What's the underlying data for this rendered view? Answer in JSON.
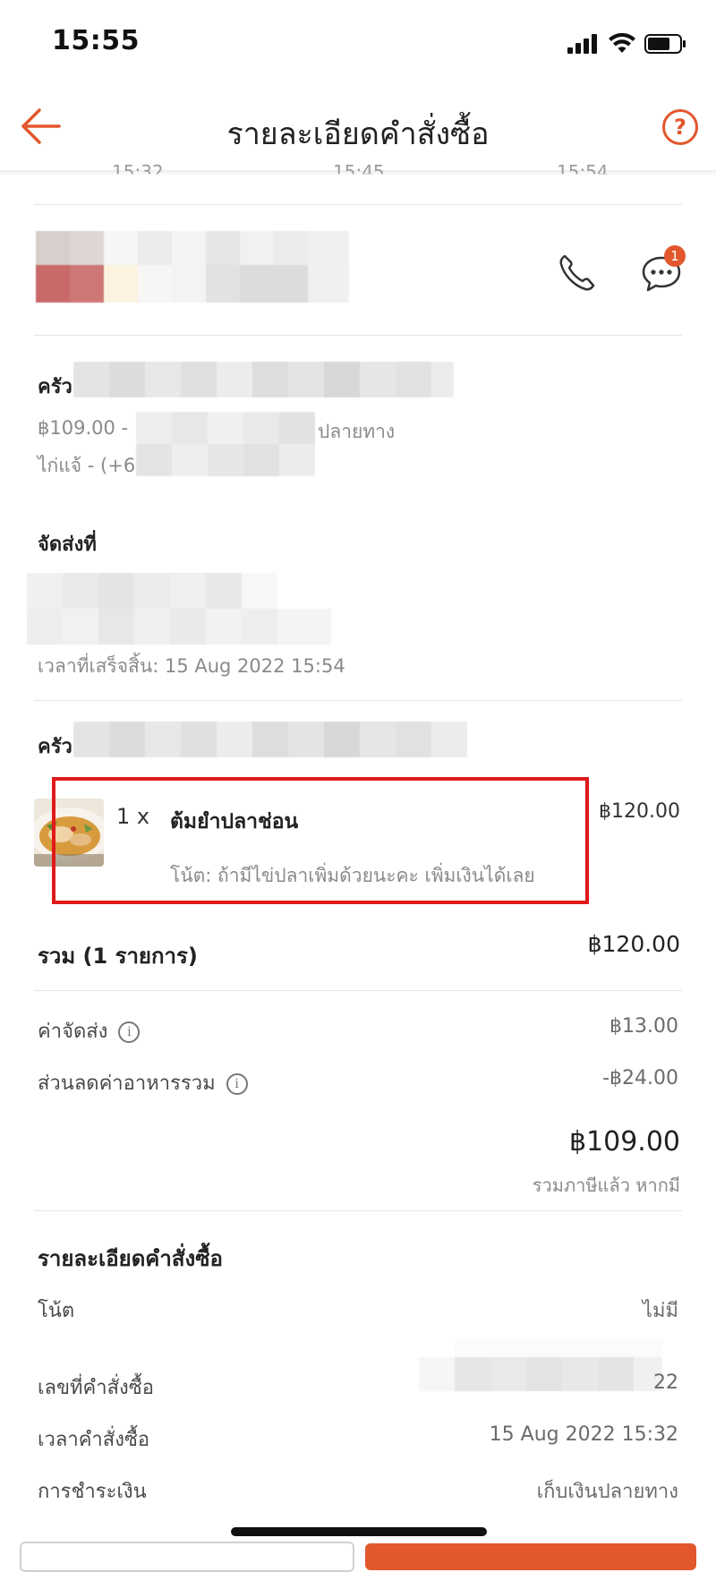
{
  "status_bar": {
    "time": "15:55"
  },
  "header": {
    "title": "รายละเอียดคำสั่งซื้อ",
    "help_symbol": "?"
  },
  "timeline": {
    "times": [
      "15:32",
      "15:45",
      "15:54"
    ]
  },
  "driver": {
    "chat_badge": "1"
  },
  "pickup": {
    "title_prefix": "ครัว",
    "price_line_prefix": "฿109.00 -",
    "price_line_suffix": "ปลายทาง",
    "contact_prefix": "ไก่แจ้ - (+6"
  },
  "delivery": {
    "title": "จัดส่งที่",
    "completed_time": "เวลาที่เสร็จสิ้น: 15 Aug 2022 15:54"
  },
  "order": {
    "restaurant_prefix": "ครัว",
    "item": {
      "qty": "1 x",
      "name": "ต้มยำปลาช่อน",
      "note": "โน้ต: ถ้ามีไข่ปลาเพิ่มด้วยนะคะ เพิ่มเงินได้เลย",
      "price": "฿120.00"
    },
    "subtotal_label": "รวม (1 รายการ)",
    "subtotal_value": "฿120.00",
    "delivery_fee_label": "ค่าจัดส่ง",
    "delivery_fee_value": "฿13.00",
    "discount_label": "ส่วนลดค่าอาหารรวม",
    "discount_value": "-฿24.00",
    "total_value": "฿109.00",
    "tax_note": "รวมภาษีแล้ว หากมี"
  },
  "details": {
    "title": "รายละเอียดคำสั่งซื้อ",
    "note_label": "โน้ต",
    "note_value": "ไม่มี",
    "order_no_label": "เลขที่คำสั่งซื้อ",
    "order_no_suffix": "22",
    "order_time_label": "เวลาคำสั่งซื้อ",
    "order_time_value": "15 Aug 2022 15:32",
    "payment_label": "การชำระเงิน",
    "payment_value": "เก็บเงินปลายทาง"
  },
  "colors": {
    "accent": "#e2572d",
    "highlight_box": "#e0191a"
  }
}
